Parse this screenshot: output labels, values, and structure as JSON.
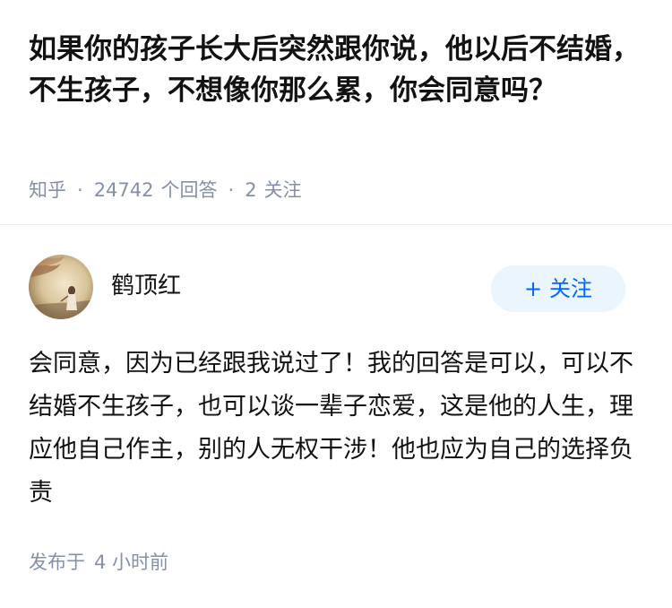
{
  "question": {
    "title": "如果你的孩子长大后突然跟你说，他以后不结婚，不生孩子，不想像你那么累，你会同意吗？",
    "source": "知乎",
    "answer_count": "24742",
    "answer_label": "个回答",
    "follow_count": "2",
    "follow_label": "关注",
    "separator": "·"
  },
  "author": {
    "name": "鹤顶红",
    "avatar_icon": "avatar-image",
    "follow_button": {
      "plus": "+",
      "label": "关注"
    }
  },
  "answer": {
    "content": "会同意，因为已经跟我说过了！我的回答是可以，可以不结婚不生孩子，也可以谈一辈子恋爱，这是他的人生，理应他自己作主，别的人无权干涉！他也应为自己的选择负责",
    "published_prefix": "发布于",
    "published_time": "4 小时前"
  },
  "colors": {
    "meta_text": "#8590a6",
    "accent_blue": "#0066ff",
    "button_bg": "#ebf5fd"
  }
}
